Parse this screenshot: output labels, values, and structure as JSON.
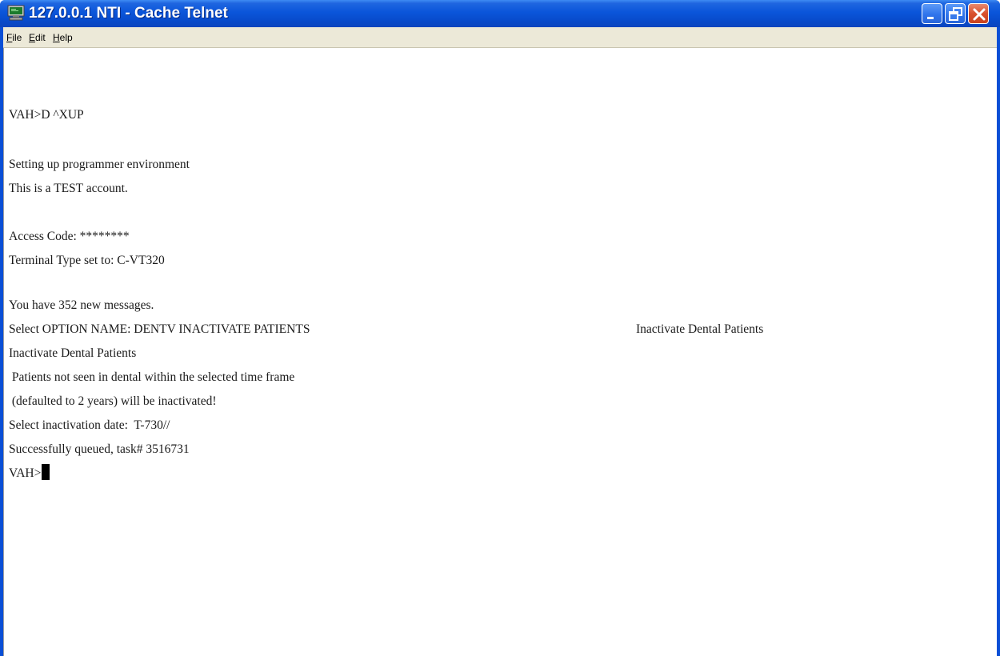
{
  "window": {
    "title": "127.0.0.1 NTI - Cache Telnet",
    "icon": "terminal-monitor-icon"
  },
  "controls": {
    "minimize_icon": "minimize-icon",
    "maximize_icon": "restore-icon",
    "close_icon": "close-icon",
    "close_color": "#d9502c",
    "titlebar_color": "#0a55da"
  },
  "menu": {
    "items": [
      "File",
      "Edit",
      "Help"
    ]
  },
  "terminal": {
    "lines": [
      "VAH>D ^XUP",
      "",
      "Setting up programmer environment",
      "This is a TEST account.",
      "",
      "Access Code: ********",
      "Terminal Type set to: C-VT320",
      "",
      "You have 352 new messages.",
      "Select OPTION NAME: DENTV INACTIVATE PATIENTS",
      "Inactivate Dental Patients",
      " Patients not seen in dental within the selected time frame",
      " (defaulted to 2 years) will be inactivated!",
      "Select inactivation date:  T-730//",
      "Successfully queued, task# 3516731",
      "VAH>"
    ],
    "option_description": "Inactivate Dental Patients"
  }
}
